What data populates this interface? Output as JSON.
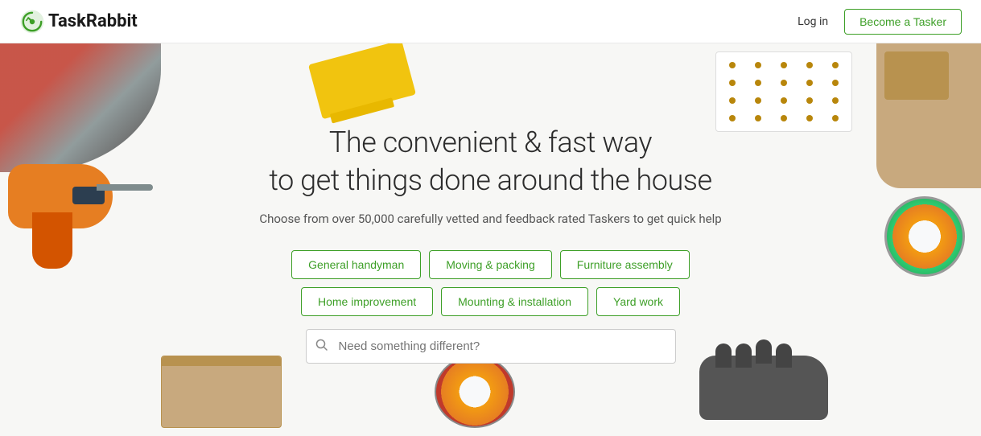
{
  "header": {
    "logo_text_task": "Task",
    "logo_text_rabbit": "Rabbit",
    "login_label": "Log in",
    "become_tasker_label": "Become a Tasker"
  },
  "hero": {
    "title_line1": "The convenient & fast way",
    "title_line2": "to get things done around the house",
    "subtitle": "Choose from over 50,000 carefully vetted and feedback rated Taskers to get quick help",
    "search_placeholder": "Need something different?"
  },
  "services": {
    "row1": [
      {
        "label": "General handyman"
      },
      {
        "label": "Moving & packing"
      },
      {
        "label": "Furniture assembly"
      }
    ],
    "row2": [
      {
        "label": "Home improvement"
      },
      {
        "label": "Mounting & installation"
      },
      {
        "label": "Yard work"
      }
    ]
  }
}
